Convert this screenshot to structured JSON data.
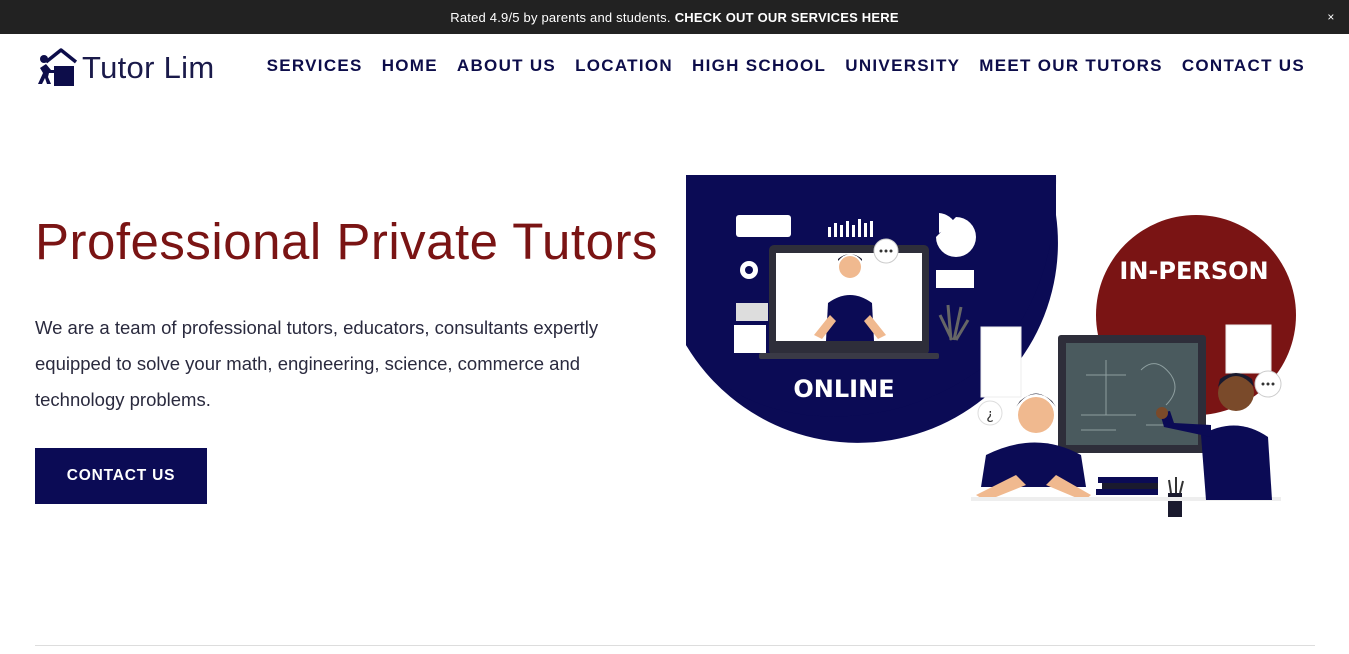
{
  "announcement": {
    "text": "Rated 4.9/5 by parents and students.",
    "link_text": "CHECK OUT OUR SERVICES HERE",
    "close_glyph": "×"
  },
  "header": {
    "logo_text": "Tutor Lim",
    "nav": [
      {
        "label": "SERVICES"
      },
      {
        "label": "HOME"
      },
      {
        "label": "ABOUT US"
      },
      {
        "label": "LOCATION"
      },
      {
        "label": "HIGH SCHOOL"
      },
      {
        "label": "UNIVERSITY"
      },
      {
        "label": "MEET OUR TUTORS"
      },
      {
        "label": "CONTACT US"
      }
    ]
  },
  "hero": {
    "title": "Professional Private Tutors",
    "description": "We are a team of professional tutors, educators, consultants expertly equipped to solve your math, engineering, science, commerce and technology problems.",
    "cta_label": "CONTACT US",
    "illustration": {
      "online_label": "ONLINE",
      "inperson_label": "IN-PERSON"
    }
  },
  "colors": {
    "navy": "#0b0b55",
    "maroon": "#7a1414",
    "announce_bg": "#222222"
  }
}
